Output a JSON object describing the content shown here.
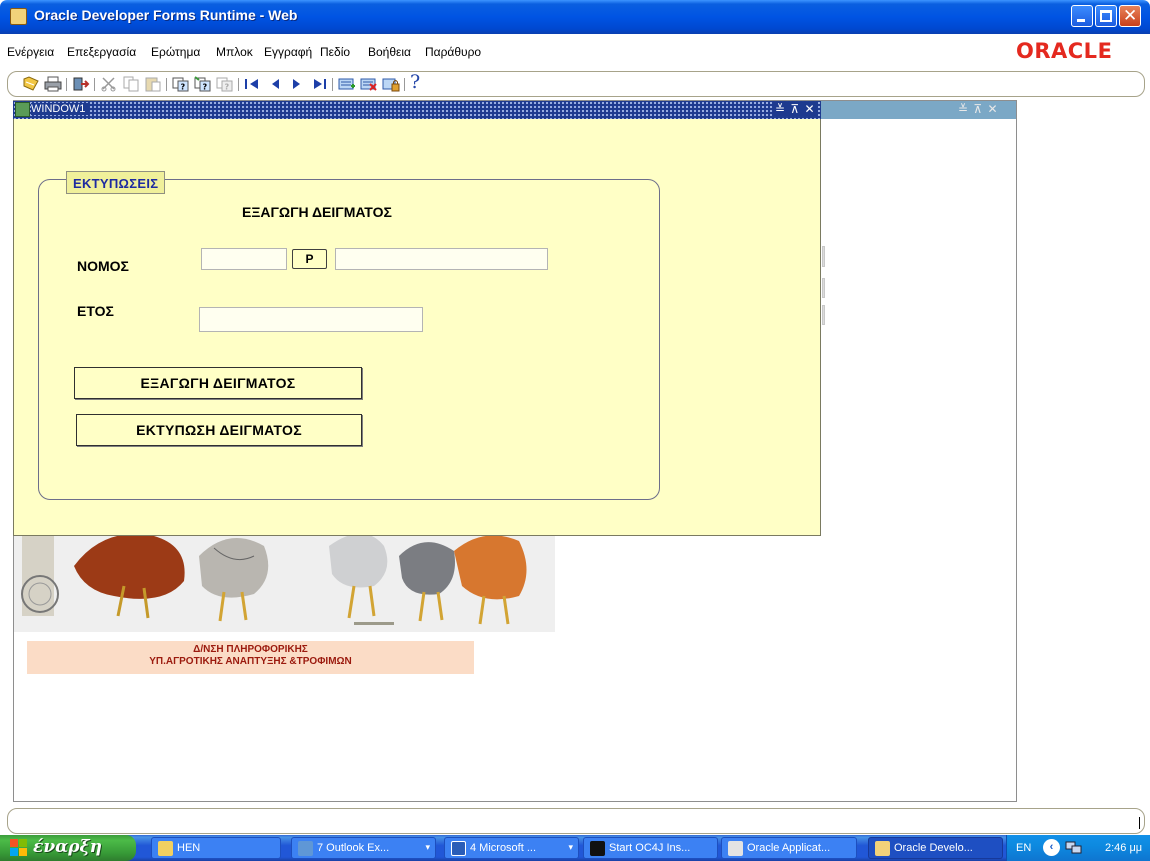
{
  "window": {
    "title": "Oracle Developer Forms Runtime - Web",
    "controls": {
      "minimize": "_",
      "maximize": "□",
      "close": "✕"
    }
  },
  "menubar": {
    "items": [
      "Ενέργεια",
      "Επεξεργασία",
      "Ερώτημα",
      "Μπλοκ",
      "Εγγραφή",
      "Πεδίο",
      "Βοήθεια",
      "Παράθυρο"
    ],
    "logo": "ORACLE"
  },
  "toolbar": {
    "icons": [
      "save-icon",
      "print-icon",
      "exit-icon",
      "cut-icon",
      "copy-icon",
      "paste-icon",
      "enter-query-icon",
      "execute-query-icon",
      "cancel-query-icon",
      "previous-block-icon",
      "previous-record-icon",
      "next-record-icon",
      "next-block-icon",
      "insert-record-icon",
      "delete-record-icon",
      "lock-record-icon",
      "help-icon"
    ],
    "help_glyph": "?"
  },
  "window1": {
    "title": "WINDOW1",
    "controls": "≚ ⊼ ✕",
    "outer_controls": "≚ ⊼ ✕"
  },
  "form": {
    "frame_title": "ΕΚΤΥΠΩΣΕΙΣ",
    "heading": "ΕΞΑΓΩΓΗ ΔΕΙΓΜΑΤΟΣ",
    "nomos_label": "ΝΟΜΟΣ",
    "nomos_code": "",
    "nomos_name": "",
    "lov_button": "P",
    "etos_label": "ΕΤΟΣ",
    "etos_value": "",
    "export_button": "ΕΞΑΓΩΓΗ ΔΕΙΓΜΑΤΟΣ",
    "print_button": "ΕΚΤΥΠΩΣΗ ΔΕΙΓΜΑΤΟΣ"
  },
  "background": {
    "credits_line1": "Δ/ΝΣΗ ΠΛΗΡΟΦΟΡΙΚΗΣ",
    "credits_line2": "ΥΠ.ΑΓΡΟΤΙΚΗΣ ΑΝΑΠΤΥΞΗΣ &ΤΡΟΦΙΜΩΝ"
  },
  "taskbar": {
    "start_label": "έναρξη",
    "tasks": [
      {
        "label": "HEN",
        "arrow": ""
      },
      {
        "label": "7 Outlook Ex...",
        "arrow": "▾"
      },
      {
        "label": "4 Microsoft ...",
        "arrow": "▾"
      },
      {
        "label": "Start OC4J Ins...",
        "arrow": ""
      },
      {
        "label": "Oracle Applicat...",
        "arrow": ""
      },
      {
        "label": "Oracle Develo...",
        "arrow": ""
      }
    ],
    "language": "EN",
    "tray_chevron": "‹",
    "clock": "2:46 μμ"
  },
  "colors": {
    "canvas": "#ffffc6",
    "frame_title_text": "#1d2aa0",
    "oracle_red": "#e4291f",
    "credits_text": "#9b1a0e",
    "credits_bg": "#fbdcc6"
  }
}
